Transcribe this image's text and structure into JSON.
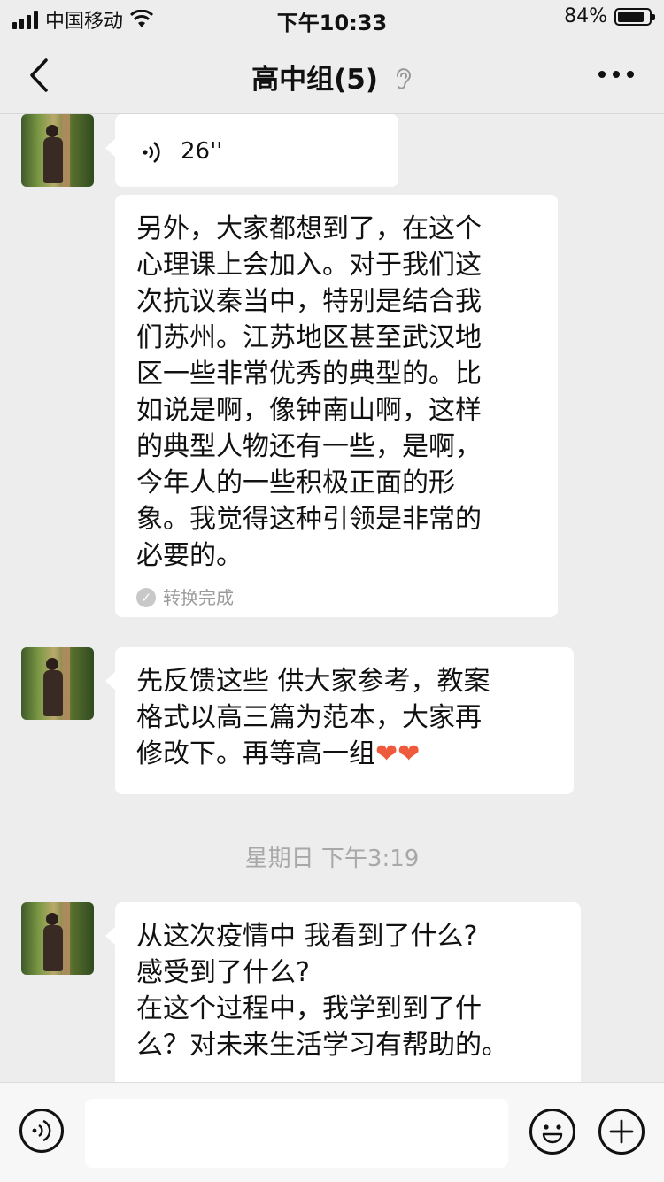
{
  "status_bar": {
    "carrier": "中国移动",
    "time": "下午10:33",
    "battery": "84%",
    "battery_level": 0.84
  },
  "nav": {
    "title": "高中组(5)"
  },
  "messages": [
    {
      "type": "voice",
      "duration": "26''"
    },
    {
      "type": "text",
      "lines": [
        "另外，大家都想到了，在这个",
        "心理课上会加入。对于我们这",
        "次抗议秦当中，特别是结合我",
        "们苏州。江苏地区甚至武汉地",
        "区一些非常优秀的典型的。比",
        "如说是啊，像钟南山啊，这样",
        "的典型人物还有一些，是啊，",
        "今年人的一些积极正面的形",
        "象。我觉得这种引领是非常的",
        "必要的。"
      ],
      "status": "转换完成"
    },
    {
      "type": "text",
      "lines": [
        " 先反馈这些 供大家参考，教案",
        "格式以高三篇为范本，大家再",
        "修改下。再等高一组"
      ],
      "hearts": "❤❤"
    },
    {
      "type": "timestamp",
      "text": "星期日 下午3:19"
    },
    {
      "type": "text",
      "lines": [
        "从这次疫情中 我看到了什么?",
        "感受到了什么?",
        "在这个过程中，我学到到了什",
        "么？对未来生活学习有帮助的。"
      ]
    }
  ],
  "icons": {
    "back": "chevron-left-icon",
    "ear": "ear-icon",
    "more": "more-icon",
    "voice": "voice-icon",
    "emoji": "emoji-icon",
    "add": "add-icon"
  }
}
